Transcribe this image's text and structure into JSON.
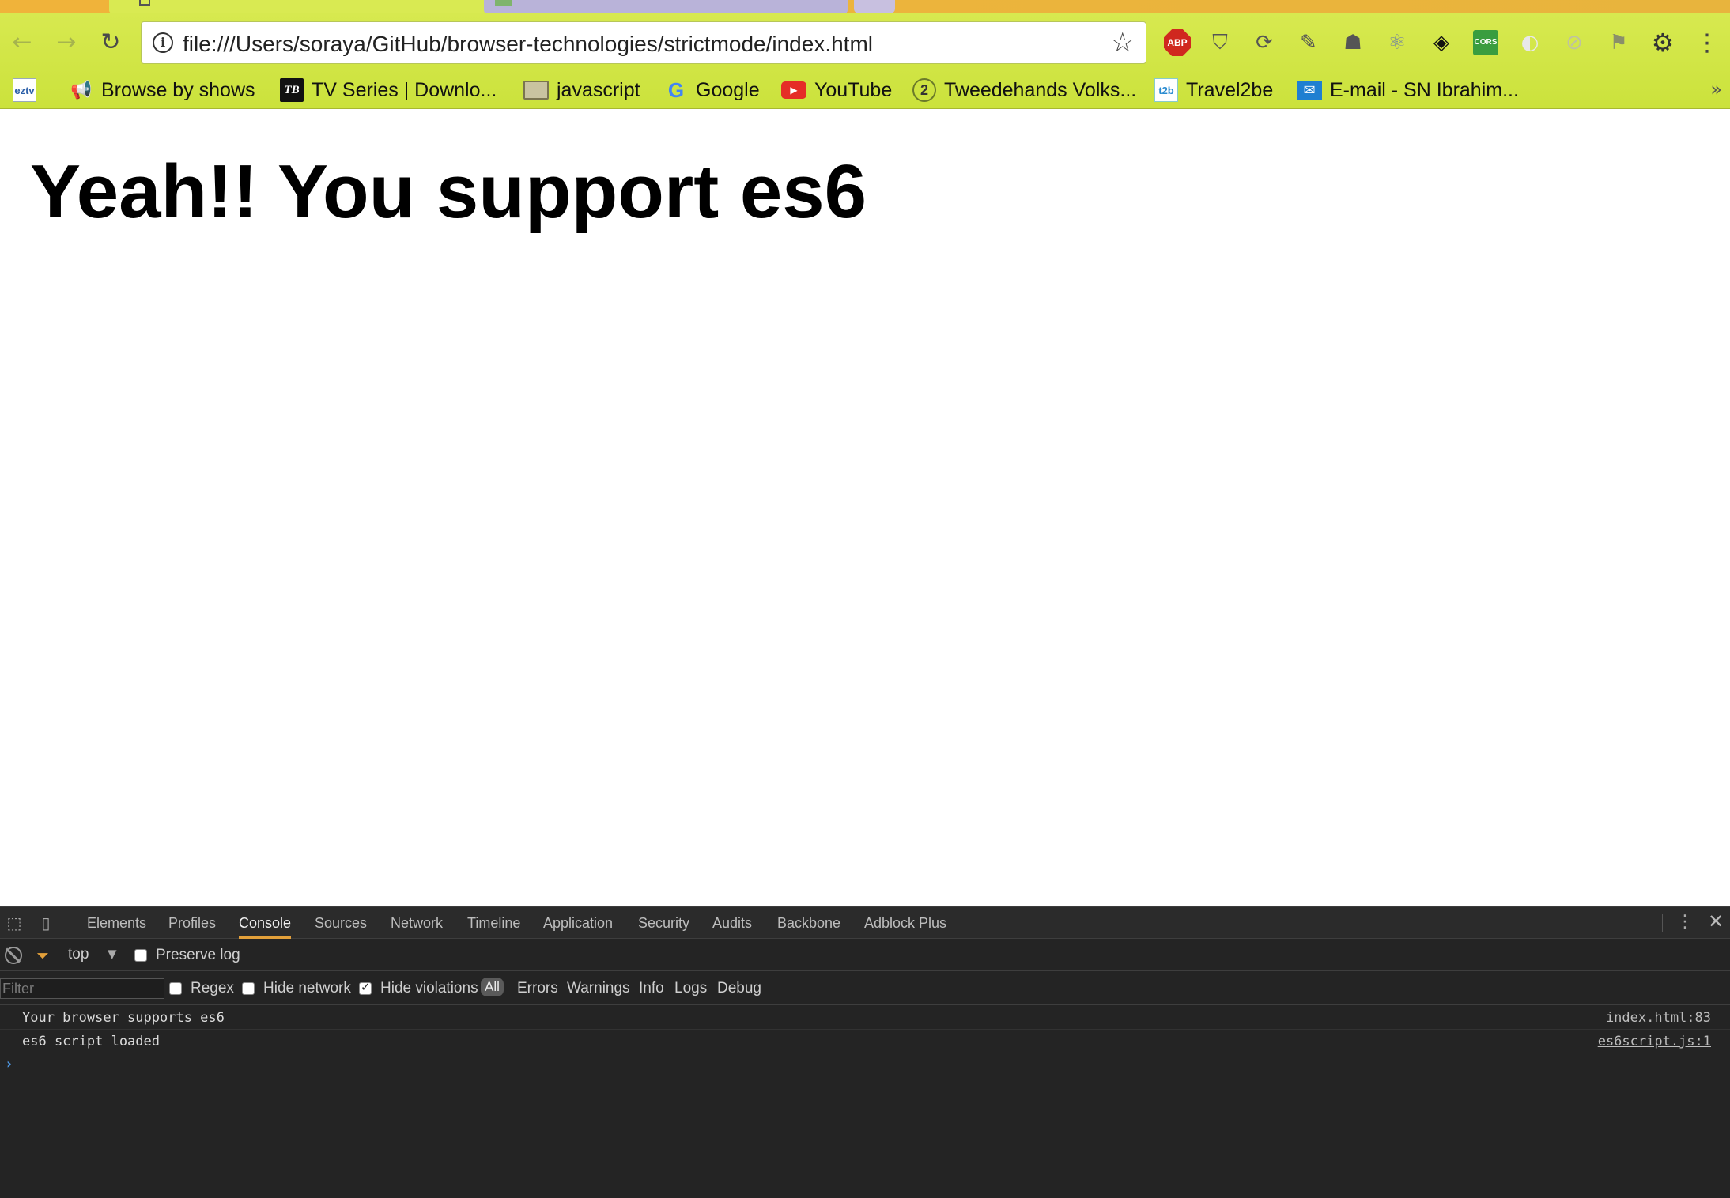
{
  "browser": {
    "url": "file:///Users/soraya/GitHub/browser-technologies/strictmode/index.html",
    "extensions": [
      {
        "name": "adblock-plus",
        "label": "ABP"
      },
      {
        "name": "cors",
        "label": "CORS"
      }
    ],
    "bookmarks": [
      {
        "label": "",
        "icon_text": "eztv"
      },
      {
        "label": "Browse by shows",
        "icon_text": ""
      },
      {
        "label": "TV Series | Downlo...",
        "icon_text": "TB"
      },
      {
        "label": "javascript",
        "icon_text": ""
      },
      {
        "label": "Google",
        "icon_text": "G"
      },
      {
        "label": "YouTube",
        "icon_text": "▶"
      },
      {
        "label": "Tweedehands Volks...",
        "icon_text": "2"
      },
      {
        "label": "Travel2be",
        "icon_text": "t2b"
      },
      {
        "label": "E-mail - SN Ibrahim...",
        "icon_text": "✉"
      }
    ]
  },
  "page": {
    "heading": "Yeah!! You support es6"
  },
  "devtools": {
    "tabs": [
      "Elements",
      "Profiles",
      "Console",
      "Sources",
      "Network",
      "Timeline",
      "Application",
      "Security",
      "Audits",
      "Backbone",
      "Adblock Plus"
    ],
    "active_tab": "Console",
    "context": "top",
    "preserve_log_label": "Preserve log",
    "filter_placeholder": "Filter",
    "regex_label": "Regex",
    "hide_network_label": "Hide network",
    "hide_violations_label": "Hide violations",
    "hide_violations_checked": true,
    "levels": [
      "All",
      "Errors",
      "Warnings",
      "Info",
      "Logs",
      "Debug"
    ],
    "messages": [
      {
        "text": "Your browser supports es6",
        "source": "index.html:83"
      },
      {
        "text": "es6 script loaded",
        "source": "es6script.js:1"
      }
    ]
  },
  "colors": {
    "chrome_bg": "#d9ea52",
    "devtools_bg": "#242424",
    "active_tab_underline": "#e3a03a",
    "prompt": "#4f9ae8"
  }
}
